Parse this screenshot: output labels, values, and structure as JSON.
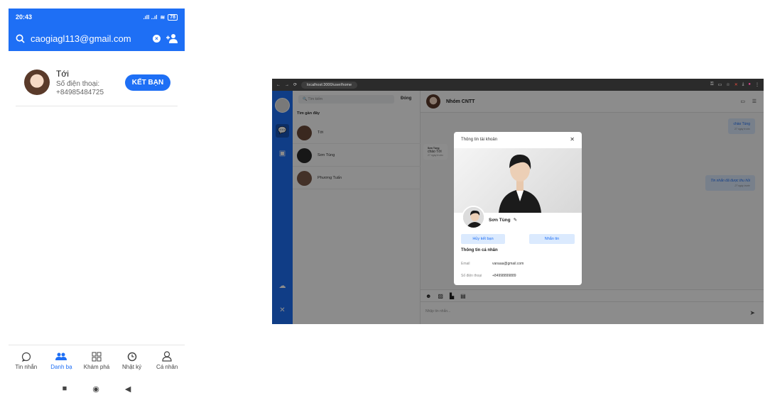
{
  "phone": {
    "status": {
      "time": "20:43",
      "signal": ".ıll ..ıl",
      "battery": "78"
    },
    "search": {
      "query": "caogiagl113@gmail.com"
    },
    "result": {
      "name": "Tới",
      "phone_label": "Số điện thoại:",
      "phone": "+84985484725",
      "button": "KẾT BẠN"
    },
    "nav": [
      {
        "label": "Tin nhắn",
        "icon": "chat-icon",
        "glyph": "◯"
      },
      {
        "label": "Danh bạ",
        "icon": "contacts-icon",
        "glyph": "👥"
      },
      {
        "label": "Khám phá",
        "icon": "grid-icon",
        "glyph": "⊞"
      },
      {
        "label": "Nhật ký",
        "icon": "clock-icon",
        "glyph": "◷"
      },
      {
        "label": "Cá nhân",
        "icon": "person-icon",
        "glyph": "♙"
      }
    ],
    "sys_nav": [
      "■",
      "◉",
      "◀"
    ]
  },
  "desktop": {
    "url": "localhost:3000/user/home",
    "search_placeholder": "Tìm kiếm",
    "close_label": "Đóng",
    "recent_header": "Tìm gần đây",
    "contacts": [
      {
        "name": "Tới",
        "color": "#6b4a3a"
      },
      {
        "name": "Sơn Tùng",
        "color": "#2a2a2a"
      },
      {
        "name": "Phương Tuấn",
        "color": "#7a5a4a"
      }
    ],
    "chat": {
      "group_name": "Nhóm CNTT",
      "msg1": {
        "text": "chào Tùng",
        "time": "27 ngày trước"
      },
      "msg2": {
        "sender": "Sơn Tùng",
        "text": "chào Tới",
        "time": "27 ngày trước"
      },
      "msg3": {
        "text": "Tin nhắn đã được thu hồi",
        "time": "27 ngày trước"
      },
      "input_placeholder": "Nhập tin nhắn..."
    },
    "modal": {
      "title": "Thông tin tài khoản",
      "name": "Sơn Tùng",
      "unfriend": "Hủy kết bạn",
      "message": "Nhắn tin",
      "section": "Thông tin cá nhân",
      "email_label": "Email",
      "email": "vanaaa@gmail.com",
      "phone_label": "Số điện thoại",
      "phone": "+84998899889"
    }
  },
  "colors": {
    "primary": "#1e6ff5"
  }
}
